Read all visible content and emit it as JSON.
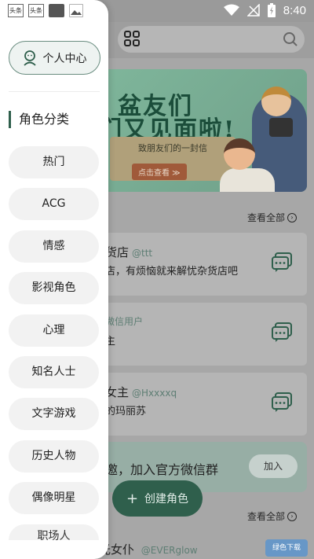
{
  "status_bar": {
    "time": "8:40",
    "notif_a": "头条",
    "notif_b": "头条"
  },
  "main": {
    "banner": {
      "title_line1": "盆友们",
      "title_line2": "们又见面啦!",
      "letter_text": "致朋友们的一封信",
      "cta": "点击查看 ≫"
    },
    "see_all_1": "查看全部",
    "see_all_2": "查看全部",
    "cards": [
      {
        "name": "货店",
        "handle": "@ttt",
        "desc": "店，有烦恼就来解忧杂货店吧"
      },
      {
        "name": "",
        "handle": "微信用户",
        "desc": "主"
      },
      {
        "name": "女主",
        "handle": "@Hxxxxq",
        "desc": "的玛丽苏"
      }
    ],
    "wechat": {
      "text": "邀，加入官方微信群",
      "join_label": "加入"
    },
    "fab_label": "创建角色",
    "last_card": {
      "name": "光女仆",
      "handle": "@EVERglow"
    },
    "watermark": "绿色下载"
  },
  "drawer": {
    "profile_label": "个人中心",
    "section_title": "角色分类",
    "categories": [
      "热门",
      "ACG",
      "情感",
      "影视角色",
      "心理",
      "知名人士",
      "文字游戏",
      "历史人物",
      "偶像明星",
      "职场人"
    ]
  },
  "colors": {
    "accent": "#2f5f4c",
    "handle": "#5e7e74"
  }
}
